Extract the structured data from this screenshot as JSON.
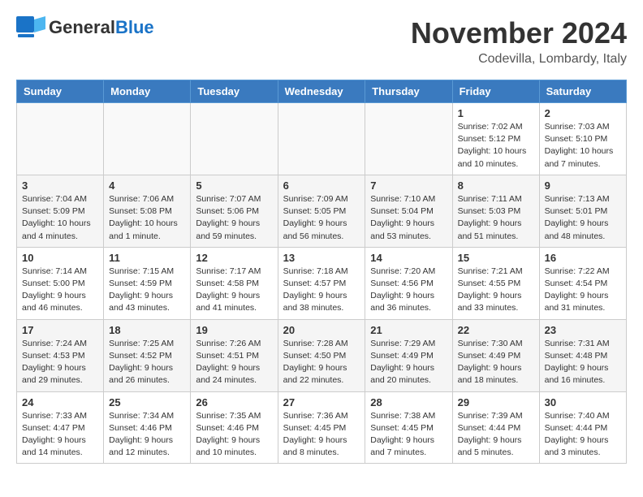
{
  "header": {
    "logo_general": "General",
    "logo_blue": "Blue",
    "month_title": "November 2024",
    "location": "Codevilla, Lombardy, Italy"
  },
  "weekdays": [
    "Sunday",
    "Monday",
    "Tuesday",
    "Wednesday",
    "Thursday",
    "Friday",
    "Saturday"
  ],
  "weeks": [
    [
      {
        "day": "",
        "info": ""
      },
      {
        "day": "",
        "info": ""
      },
      {
        "day": "",
        "info": ""
      },
      {
        "day": "",
        "info": ""
      },
      {
        "day": "",
        "info": ""
      },
      {
        "day": "1",
        "info": "Sunrise: 7:02 AM\nSunset: 5:12 PM\nDaylight: 10 hours\nand 10 minutes."
      },
      {
        "day": "2",
        "info": "Sunrise: 7:03 AM\nSunset: 5:10 PM\nDaylight: 10 hours\nand 7 minutes."
      }
    ],
    [
      {
        "day": "3",
        "info": "Sunrise: 7:04 AM\nSunset: 5:09 PM\nDaylight: 10 hours\nand 4 minutes."
      },
      {
        "day": "4",
        "info": "Sunrise: 7:06 AM\nSunset: 5:08 PM\nDaylight: 10 hours\nand 1 minute."
      },
      {
        "day": "5",
        "info": "Sunrise: 7:07 AM\nSunset: 5:06 PM\nDaylight: 9 hours\nand 59 minutes."
      },
      {
        "day": "6",
        "info": "Sunrise: 7:09 AM\nSunset: 5:05 PM\nDaylight: 9 hours\nand 56 minutes."
      },
      {
        "day": "7",
        "info": "Sunrise: 7:10 AM\nSunset: 5:04 PM\nDaylight: 9 hours\nand 53 minutes."
      },
      {
        "day": "8",
        "info": "Sunrise: 7:11 AM\nSunset: 5:03 PM\nDaylight: 9 hours\nand 51 minutes."
      },
      {
        "day": "9",
        "info": "Sunrise: 7:13 AM\nSunset: 5:01 PM\nDaylight: 9 hours\nand 48 minutes."
      }
    ],
    [
      {
        "day": "10",
        "info": "Sunrise: 7:14 AM\nSunset: 5:00 PM\nDaylight: 9 hours\nand 46 minutes."
      },
      {
        "day": "11",
        "info": "Sunrise: 7:15 AM\nSunset: 4:59 PM\nDaylight: 9 hours\nand 43 minutes."
      },
      {
        "day": "12",
        "info": "Sunrise: 7:17 AM\nSunset: 4:58 PM\nDaylight: 9 hours\nand 41 minutes."
      },
      {
        "day": "13",
        "info": "Sunrise: 7:18 AM\nSunset: 4:57 PM\nDaylight: 9 hours\nand 38 minutes."
      },
      {
        "day": "14",
        "info": "Sunrise: 7:20 AM\nSunset: 4:56 PM\nDaylight: 9 hours\nand 36 minutes."
      },
      {
        "day": "15",
        "info": "Sunrise: 7:21 AM\nSunset: 4:55 PM\nDaylight: 9 hours\nand 33 minutes."
      },
      {
        "day": "16",
        "info": "Sunrise: 7:22 AM\nSunset: 4:54 PM\nDaylight: 9 hours\nand 31 minutes."
      }
    ],
    [
      {
        "day": "17",
        "info": "Sunrise: 7:24 AM\nSunset: 4:53 PM\nDaylight: 9 hours\nand 29 minutes."
      },
      {
        "day": "18",
        "info": "Sunrise: 7:25 AM\nSunset: 4:52 PM\nDaylight: 9 hours\nand 26 minutes."
      },
      {
        "day": "19",
        "info": "Sunrise: 7:26 AM\nSunset: 4:51 PM\nDaylight: 9 hours\nand 24 minutes."
      },
      {
        "day": "20",
        "info": "Sunrise: 7:28 AM\nSunset: 4:50 PM\nDaylight: 9 hours\nand 22 minutes."
      },
      {
        "day": "21",
        "info": "Sunrise: 7:29 AM\nSunset: 4:49 PM\nDaylight: 9 hours\nand 20 minutes."
      },
      {
        "day": "22",
        "info": "Sunrise: 7:30 AM\nSunset: 4:49 PM\nDaylight: 9 hours\nand 18 minutes."
      },
      {
        "day": "23",
        "info": "Sunrise: 7:31 AM\nSunset: 4:48 PM\nDaylight: 9 hours\nand 16 minutes."
      }
    ],
    [
      {
        "day": "24",
        "info": "Sunrise: 7:33 AM\nSunset: 4:47 PM\nDaylight: 9 hours\nand 14 minutes."
      },
      {
        "day": "25",
        "info": "Sunrise: 7:34 AM\nSunset: 4:46 PM\nDaylight: 9 hours\nand 12 minutes."
      },
      {
        "day": "26",
        "info": "Sunrise: 7:35 AM\nSunset: 4:46 PM\nDaylight: 9 hours\nand 10 minutes."
      },
      {
        "day": "27",
        "info": "Sunrise: 7:36 AM\nSunset: 4:45 PM\nDaylight: 9 hours\nand 8 minutes."
      },
      {
        "day": "28",
        "info": "Sunrise: 7:38 AM\nSunset: 4:45 PM\nDaylight: 9 hours\nand 7 minutes."
      },
      {
        "day": "29",
        "info": "Sunrise: 7:39 AM\nSunset: 4:44 PM\nDaylight: 9 hours\nand 5 minutes."
      },
      {
        "day": "30",
        "info": "Sunrise: 7:40 AM\nSunset: 4:44 PM\nDaylight: 9 hours\nand 3 minutes."
      }
    ]
  ]
}
